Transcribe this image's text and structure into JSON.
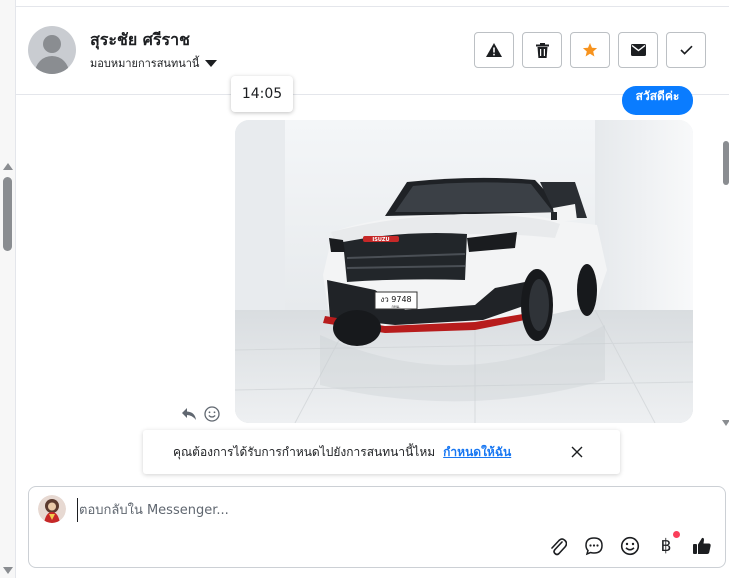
{
  "header": {
    "contact_name": "สุระชัย ศรีราช",
    "assign_label": "มอบหมายการสนทนานี้",
    "actions": [
      {
        "name": "spam-button",
        "icon": "warning-icon"
      },
      {
        "name": "delete-button",
        "icon": "trash-icon"
      },
      {
        "name": "star-button",
        "icon": "star-icon",
        "color": "#f7931e"
      },
      {
        "name": "mark-unread-button",
        "icon": "envelope-icon"
      },
      {
        "name": "mark-done-button",
        "icon": "check-icon"
      }
    ]
  },
  "conversation": {
    "timestamp": "14:05",
    "outgoing_text": "สวัสดีค่ะ",
    "image": {
      "plate_text": "งว 9748",
      "plate_sub": "กทม.",
      "brand_badge": "ISUZU"
    }
  },
  "suggestion": {
    "text": "คุณต้องการได้รับการกำหนดไปยังการสนทนานี้ไหม",
    "link": "กำหนดให้ฉัน"
  },
  "composer": {
    "placeholder": "ตอบกลับใน Messenger...",
    "tools": [
      "attach-icon",
      "saved-replies-icon",
      "emoji-icon",
      "payment-icon",
      "like-icon"
    ]
  },
  "colors": {
    "accent": "#0a7cff",
    "link": "#1877f2",
    "star": "#f7931e",
    "notification_dot": "#fa3e5a"
  }
}
